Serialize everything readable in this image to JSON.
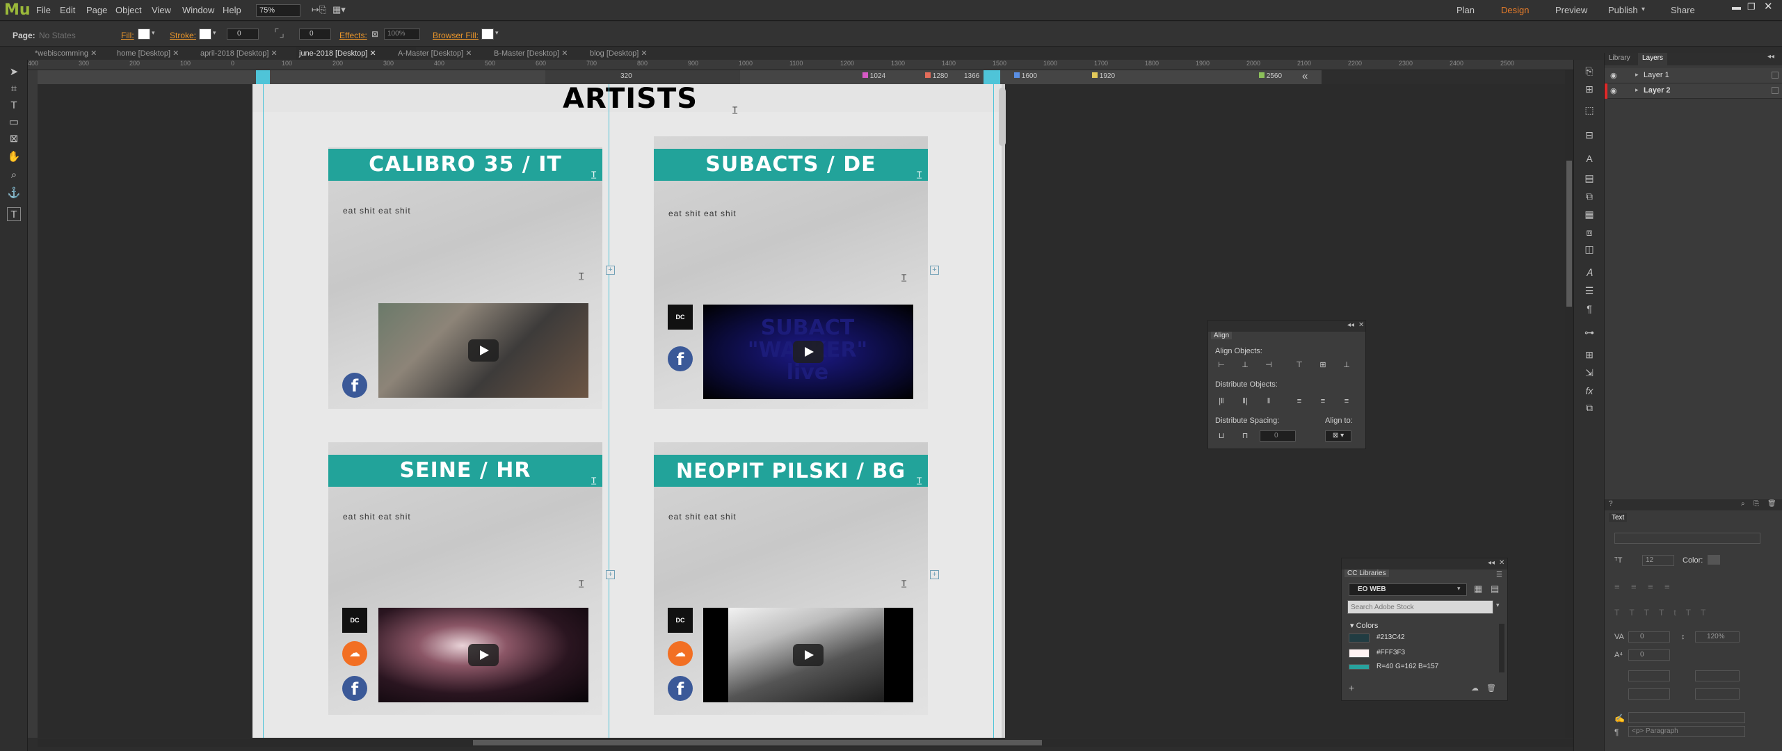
{
  "app": {
    "logo": "Mu",
    "menu": [
      "File",
      "Edit",
      "Page",
      "Object",
      "View",
      "Window",
      "Help"
    ],
    "zoom": "75%",
    "modes": [
      "Plan",
      "Design",
      "Preview",
      "Publish",
      "Share"
    ],
    "active_mode": "Design"
  },
  "control_bar": {
    "page_label": "Page:",
    "page_value": "No States",
    "fill_label": "Fill:",
    "stroke_label": "Stroke:",
    "stroke_value": "0",
    "rotate_value": "0",
    "effects_label": "Effects:",
    "effects_value": "100%",
    "browser_fill_label": "Browser Fill:"
  },
  "tabs": [
    "*webiscomming",
    "home [Desktop]",
    "april-2018 [Desktop]",
    "june-2018 [Desktop]",
    "A-Master [Desktop]",
    "B-Master [Desktop]",
    "blog [Desktop]"
  ],
  "active_tab": 3,
  "ruler_ticks": [
    "400",
    "300",
    "200",
    "100",
    "0",
    "100",
    "200",
    "300",
    "400",
    "500",
    "600",
    "700",
    "800",
    "900",
    "1000",
    "1100",
    "1200",
    "1300",
    "1400",
    "1500",
    "1600",
    "1700",
    "1800",
    "1900",
    "2000",
    "2100",
    "2200",
    "2300",
    "2400",
    "2500"
  ],
  "breakpoints": [
    "320",
    "1024",
    "1280",
    "1366",
    "1600",
    "1920",
    "2560"
  ],
  "page_heading": "ARTISTS",
  "cards": [
    {
      "title": "CALIBRO 35 / IT",
      "text": "eat  shit  eat  shit",
      "social": [
        "facebook"
      ]
    },
    {
      "title": "SUBACTS / DE",
      "text": "eat  shit  eat  shit",
      "social": [
        "discogs",
        "facebook"
      ],
      "video_text": "SUBACT \"WALKER\" live"
    },
    {
      "title": "SEINE / HR",
      "text": "eat  shit  eat  shit",
      "social": [
        "discogs",
        "soundcloud",
        "facebook"
      ]
    },
    {
      "title": "NEOPIT PILSKI / BG",
      "text": "eat  shit  eat  shit",
      "social": [
        "discogs",
        "soundcloud",
        "facebook"
      ]
    }
  ],
  "align_panel": {
    "tab": "Align",
    "align_objects": "Align Objects:",
    "distribute_objects": "Distribute Objects:",
    "distribute_spacing": "Distribute Spacing:",
    "align_to": "Align to:",
    "spacing_value": "0"
  },
  "cc_libraries": {
    "tab": "CC Libraries",
    "library": "EO WEB",
    "search_placeholder": "Search Adobe Stock",
    "section": "Colors",
    "colors": [
      {
        "name": "#213C42",
        "hex": "#213C42"
      },
      {
        "name": "#FFF3F3",
        "hex": "#FFF3F3"
      },
      {
        "name": "R=40 G=162 B=157",
        "hex": "#28A29D"
      }
    ]
  },
  "right_panel": {
    "tabs": [
      "Library",
      "Layers"
    ],
    "active_tab": "Layers",
    "layers": [
      "Layer 1",
      "Layer 2"
    ],
    "text_tab": "Text",
    "font_size": "12",
    "color_label": "Color:",
    "leading": "120%",
    "indent_left": "0",
    "indent_right": "0",
    "paragraph": "<p> Paragraph"
  }
}
